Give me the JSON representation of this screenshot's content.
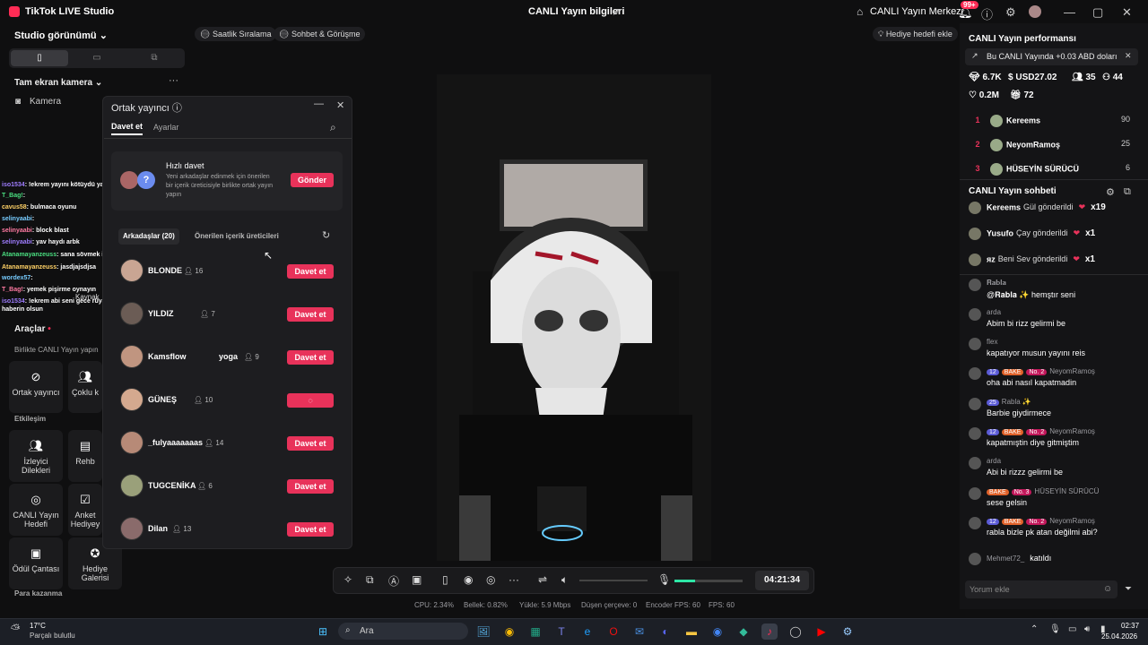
{
  "titlebar": {
    "app_title": "TikTok LIVE Studio",
    "center_title": "CANLI Yayın bilgileri",
    "merkezi": "CANLI Yayın Merkezi",
    "notif_badge": "99+"
  },
  "colors": {
    "accent": "#fe2c55",
    "invite": "#e8325a",
    "bg": "#0f0f10"
  },
  "left": {
    "studio_view": "Studio görünümü",
    "camera_group": "Tam ekran kamera",
    "camera_item": "Kamera",
    "overlay_chat": [
      {
        "user": "iso1534",
        "text": "!ekrem yayını kötüydü ya kapatmıştın"
      },
      {
        "user": "T_Bag!",
        "text": ""
      },
      {
        "user": "cavus58",
        "text": "bulmaca oyunu"
      },
      {
        "user": "selinyaabi",
        "text": ""
      },
      {
        "user": "selinyaabi",
        "text": "block blast"
      },
      {
        "user": "selinyaabi",
        "text": "yav haydı arbk"
      },
      {
        "user": "Atanamayanzeuss",
        "text": "sana sövmek için açmış olabilir"
      },
      {
        "user": "Atanamayanzeuss",
        "text": "jasdjajsdjsa"
      },
      {
        "user": "wordex57",
        "text": ""
      },
      {
        "user": "T_Bag!",
        "text": "yemek pişirme oynayın"
      },
      {
        "user": "iso1534",
        "text": "!ekrem abi seni gece rüyamda gördüm sövdüm"
      },
      {
        "user": "",
        "text": "haberin olsun"
      }
    ],
    "kaynak": "Kaynak",
    "tools_h": "Araçlar",
    "tools_sub": "Birlikte CANLI Yayın yapın",
    "t_cohost": "Ortak yayıncı",
    "t_multi": "Çoklu k",
    "etkilesim": "Etkileşim",
    "t_viewer": "İzleyici Dilekleri",
    "t_rehb": "Rehb",
    "t_goal": "CANLI Yayın Hedefi",
    "t_anket": "Anket Hediyey",
    "t_bag": "Ödül Çantası",
    "t_gallery": "Hediye Galerisi",
    "para": "Para kazanma"
  },
  "pills": {
    "p1": "Saatlik Sıralama",
    "p2": "Sohbet & Görüşme",
    "p3": "Hediye hedefi ekle"
  },
  "cohost": {
    "title": "Ortak yayıncı",
    "tab_invite": "Davet et",
    "tab_settings": "Ayarlar",
    "quick_title": "Hızlı davet",
    "quick_desc": "Yeni arkadaşlar edinmek için önerilen bir içerik üreticisiyle birlikte ortak yayın yapın",
    "send": "Gönder",
    "friends_tab": "Arkadaşlar (20)",
    "suggested_tab": "Önerilen içerik üreticileri",
    "invite_label": "Davet et",
    "friends": [
      {
        "name": "BLONDE",
        "count": "16"
      },
      {
        "name": "YILDIZ",
        "count": "7"
      },
      {
        "name": "Kamsflow",
        "extra": "yoga",
        "count": "9"
      },
      {
        "name": "GÜNEŞ",
        "count": "10",
        "loading": true
      },
      {
        "name": "_fulyaaaaaaas",
        "count": "14"
      },
      {
        "name": "TUGCENİKA",
        "count": "6"
      },
      {
        "name": "Dilan",
        "count": "13"
      }
    ]
  },
  "controls": {
    "timer": "04:21:34",
    "volume_level": 0.3
  },
  "stats": {
    "cpu": "CPU: 2.34%",
    "bellek": "Bellek: 0.82%",
    "yukle": "Yükle: 5.9 Mbps",
    "dusen": "Düşen çerçeve: 0",
    "encoder": "Encoder FPS: 60",
    "fps": "FPS: 60"
  },
  "right": {
    "perf_title": "CANLI Yayın performansı",
    "gain": "Bu CANLI Yayında +0.03 ABD doları",
    "s1": "6.7K",
    "s2": "USD27.02",
    "s3": "35",
    "s4": "44",
    "s5": "0.2M",
    "s6": "72",
    "ranking": [
      {
        "n": "1",
        "name": "Kereems",
        "score": "90"
      },
      {
        "n": "2",
        "name": "NeyomRamoş",
        "score": "25"
      },
      {
        "n": "3",
        "name": "HÜSEYİN SÜRÜCÜ",
        "score": "6"
      }
    ],
    "chat_title": "CANLI Yayın sohbeti",
    "gifts": [
      {
        "user": "Kereems",
        "act": "Gül gönderildi",
        "x": "x19"
      },
      {
        "user": "Yusufo",
        "act": "Çay gönderildi",
        "x": "x1"
      },
      {
        "user": "ᴙᴢ",
        "act": "Beni Sev gönderildi",
        "x": "x1"
      }
    ],
    "messages": [
      {
        "user": "𝐑𝐚𝐛𝐥𝐚",
        "text": "@𝐑𝐚𝐛𝐥𝐚 ✨ hemştır seni"
      },
      {
        "user": "arda",
        "text": "Abim bi rizz gelirmi be"
      },
      {
        "user": "flex",
        "text": "kapatıyor musun yayını reis"
      },
      {
        "user": "NeyomRamoş",
        "text": "oha abi nasıl kapatmadin",
        "tags": [
          "12",
          "BAKE",
          "No. 2"
        ]
      },
      {
        "user": "Rabla ✨",
        "text": "Barbie giydirmece",
        "tags": [
          "25"
        ]
      },
      {
        "user": "NeyomRamoş",
        "text": "kapatmıştin diye gitmiştim",
        "tags": [
          "12",
          "BAKE",
          "No. 2"
        ]
      },
      {
        "user": "arda",
        "text": "Abi bi rizzz gelirmi be"
      },
      {
        "user": "HÜSEYİN SÜRÜCÜ",
        "text": "sese gelsin",
        "tags": [
          "BAKE",
          "No. 3"
        ]
      },
      {
        "user": "NeyomRamoş",
        "text": "rabla bizle pk atan değilmi abi?",
        "tags": [
          "12",
          "BAKE",
          "No. 2"
        ]
      },
      {
        "user": "Mehmet72_",
        "text": "katıldı"
      }
    ],
    "chat_placeholder": "Yorum ekle"
  },
  "taskbar": {
    "temp": "17°C",
    "weather": "Parçalı bulutlu",
    "search": "Ara",
    "time": "02:37",
    "date": "25.04.2026"
  }
}
